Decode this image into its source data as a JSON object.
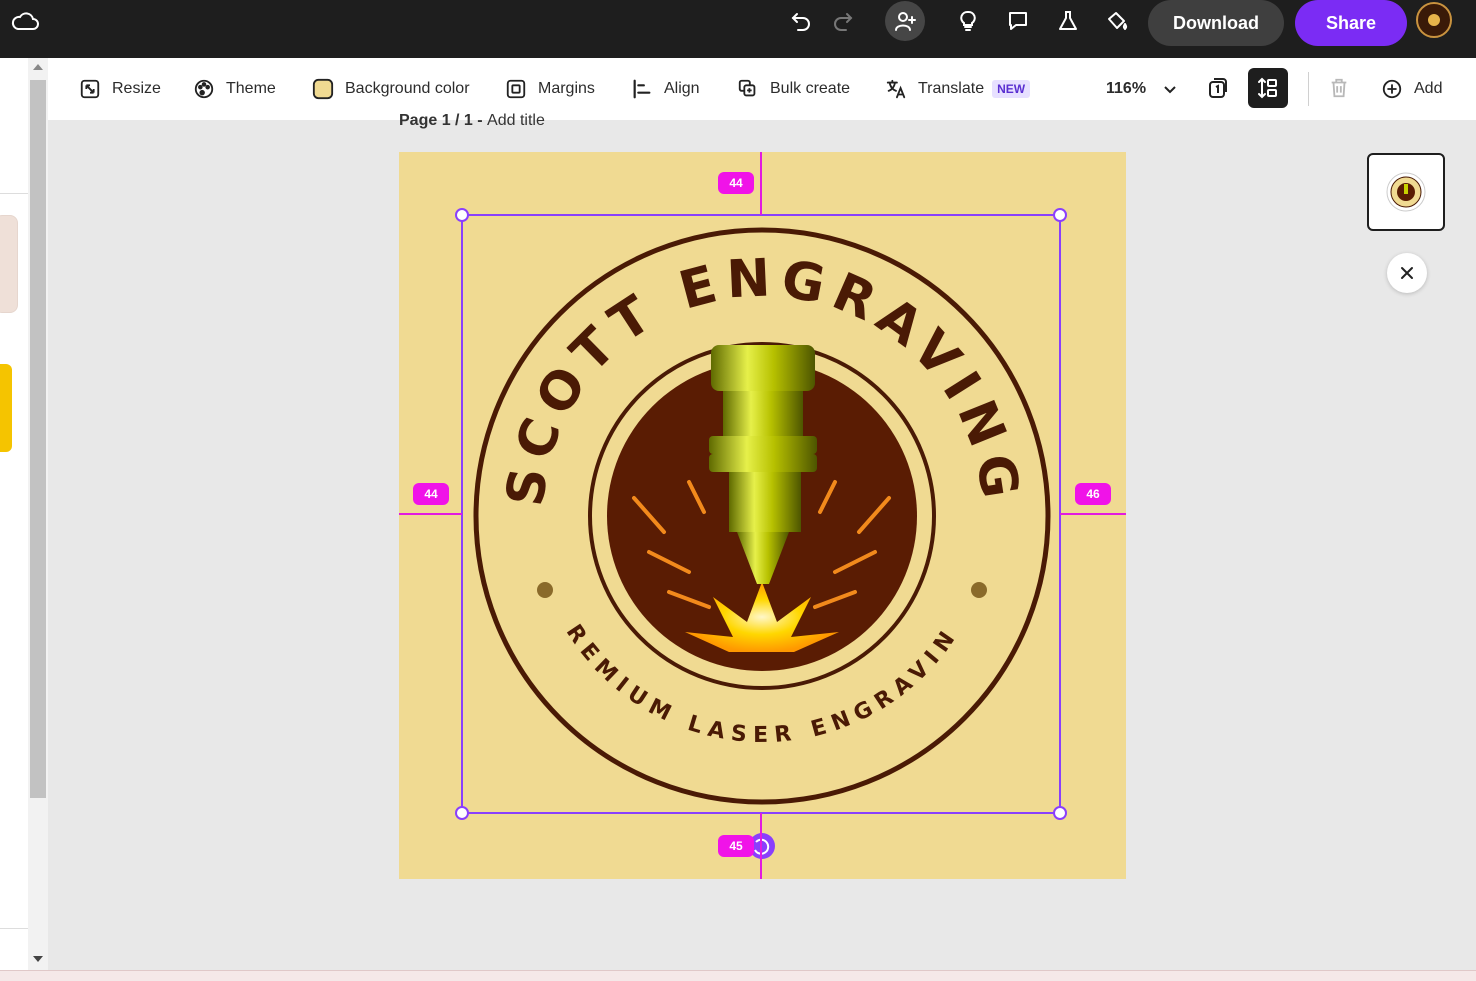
{
  "topbar": {
    "download_label": "Download",
    "share_label": "Share",
    "icons": [
      "cloud-icon",
      "undo-icon",
      "redo-icon",
      "invite-user-icon",
      "lightbulb-icon",
      "comment-icon",
      "flask-icon",
      "paint-bucket-icon",
      "avatar"
    ]
  },
  "toolbar": {
    "resize": "Resize",
    "theme": "Theme",
    "background_color": "Background color",
    "margins": "Margins",
    "align": "Align",
    "bulk_create": "Bulk create",
    "translate": "Translate",
    "new_badge": "NEW",
    "zoom": "116%",
    "add": "Add"
  },
  "page": {
    "label_prefix": "Page 1 / 1 - ",
    "label_title": "Add title",
    "background": "#f0da92"
  },
  "logo": {
    "top_text": "SCOTT ENGRAVING",
    "bottom_text": "PREMIUM LASER ENGRAVING",
    "ring_color": "#4a1a05",
    "inner_color": "#5a1c03"
  },
  "spacing": {
    "top": "44",
    "left": "44",
    "right": "46",
    "bottom": "45"
  },
  "colors": {
    "accent": "#7b2cf4",
    "guide": "#e21be0",
    "selection": "#8a3ffc"
  }
}
